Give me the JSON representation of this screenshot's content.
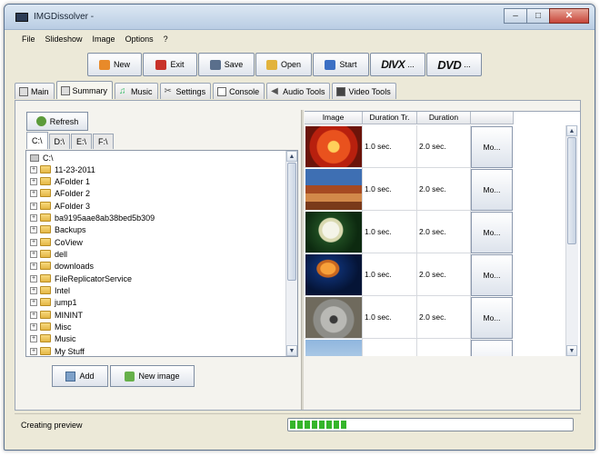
{
  "window": {
    "title": "IMGDissolver -",
    "controls": {
      "minimize": "–",
      "maximize": "□",
      "close": "✕"
    }
  },
  "menu": {
    "items": [
      "File",
      "Slideshow",
      "Image",
      "Options",
      "?"
    ]
  },
  "toolbar": {
    "new_label": "New",
    "exit_label": "Exit",
    "save_label": "Save",
    "open_label": "Open",
    "start_label": "Start",
    "divx_logo": "DIVX",
    "divx_more": "...",
    "dvd_logo": "DVD",
    "dvd_more": "..."
  },
  "tabs": [
    {
      "label": "Main"
    },
    {
      "label": "Summary",
      "active": true
    },
    {
      "label": "Music"
    },
    {
      "label": "Settings"
    },
    {
      "label": "Console"
    },
    {
      "label": "Audio Tools"
    },
    {
      "label": "Video Tools"
    }
  ],
  "browser": {
    "refresh_label": "Refresh",
    "drives": [
      "C:\\",
      "D:\\",
      "E:\\",
      "F:\\"
    ],
    "active_drive": "C:\\",
    "root": "C:\\",
    "folders": [
      "11-23-2011",
      "AFolder 1",
      "AFolder 2",
      "AFolder 3",
      "ba9195aae8ab38bed5b309",
      "Backups",
      "CoView",
      "dell",
      "downloads",
      "FileReplicatorService",
      "Intel",
      "jump1",
      "MININT",
      "Misc",
      "Music",
      "My Stuff"
    ]
  },
  "buttons": {
    "add_label": "Add",
    "new_image_label": "New image"
  },
  "grid": {
    "headers": [
      "Image",
      "Duration Tr.",
      "Duration"
    ],
    "rows": [
      {
        "image": "red-flower",
        "duration_tr": "1.0 sec.",
        "duration": "2.0 sec.",
        "more": "Mo..."
      },
      {
        "image": "desert-rock",
        "duration_tr": "1.0 sec.",
        "duration": "2.0 sec.",
        "more": "Mo..."
      },
      {
        "image": "white-flower",
        "duration_tr": "1.0 sec.",
        "duration": "2.0 sec.",
        "more": "Mo..."
      },
      {
        "image": "jellyfish",
        "duration_tr": "1.0 sec.",
        "duration": "2.0 sec.",
        "more": "Mo..."
      },
      {
        "image": "koala",
        "duration_tr": "1.0 sec.",
        "duration": "2.0 sec.",
        "more": "Mo..."
      },
      {
        "image": "lighthouse",
        "duration_tr": "",
        "duration": "",
        "more": ""
      }
    ]
  },
  "status": {
    "text": "Creating preview",
    "progress": 0.2
  },
  "colors": {
    "accent": "#35b52a",
    "panel": "#f4f3ee"
  }
}
